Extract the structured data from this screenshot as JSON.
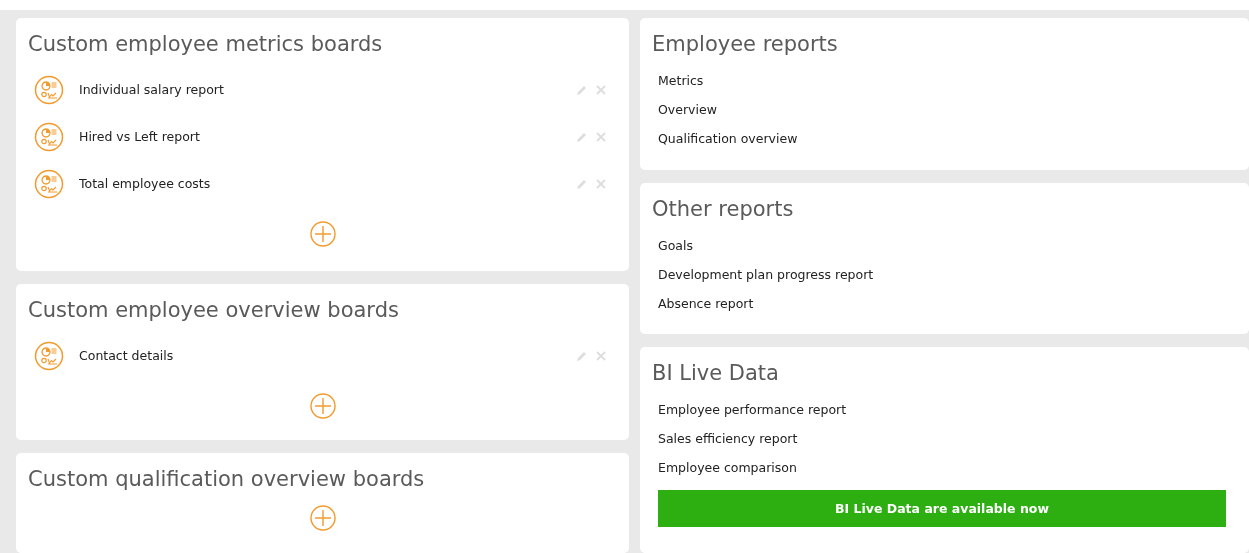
{
  "left_panels": [
    {
      "title": "Custom employee metrics boards",
      "items": [
        {
          "label": "Individual salary report"
        },
        {
          "label": "Hired vs Left report"
        },
        {
          "label": "Total employee costs"
        }
      ]
    },
    {
      "title": "Custom employee overview boards",
      "items": [
        {
          "label": "Contact details"
        }
      ]
    },
    {
      "title": "Custom qualification overview boards"
    }
  ],
  "right_panels": [
    {
      "title": "Employee reports",
      "links": [
        "Metrics",
        "Overview",
        "Qualification overview"
      ]
    },
    {
      "title": "Other reports",
      "links": [
        "Goals",
        "Development plan progress report",
        "Absence report"
      ]
    },
    {
      "title": "BI Live Data",
      "links": [
        "Employee performance report",
        "Sales efficiency report",
        "Employee comparison"
      ],
      "banner": "BI Live Data are available now"
    }
  ]
}
